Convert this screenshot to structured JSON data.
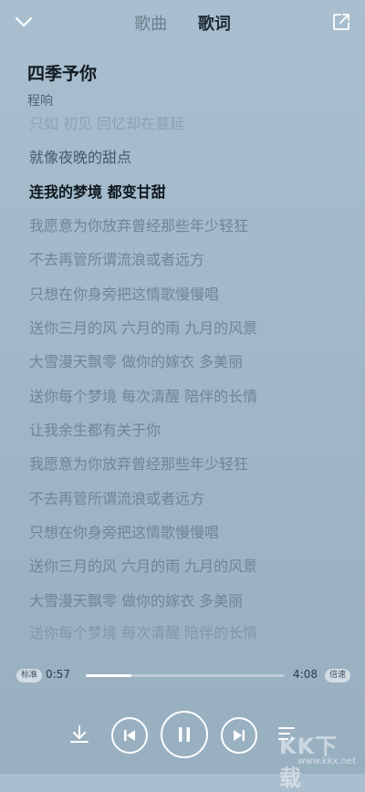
{
  "header": {
    "tabs": [
      {
        "label": "歌曲",
        "active": false
      },
      {
        "label": "歌词",
        "active": true
      }
    ],
    "icons": {
      "back": "chevron-down-icon",
      "share": "share-icon"
    }
  },
  "song": {
    "title": "四季予你",
    "artist": "程响"
  },
  "lyrics": {
    "current_index": 2,
    "lines": [
      "只如 初见 回忆却在蔓延",
      "就像夜晚的甜点",
      "连我的梦境 都变甘甜",
      "我愿意为你放弃曾经那些年少轻狂",
      "不去再管所谓流浪或者远方",
      "只想在你身旁把这情歌慢慢唱",
      "送你三月的风 六月的雨 九月的风景",
      "大雪漫天飘零 做你的嫁衣 多美丽",
      "送你每个梦境 每次清醒 陪伴的长情",
      "让我余生都有关于你",
      "我愿意为你放弃曾经那些年少轻狂",
      "不去再管所谓流浪或者远方",
      "只想在你身旁把这情歌慢慢唱",
      "送你三月的风 六月的雨 九月的风景",
      "大雪漫天飘零 做你的嫁衣 多美丽",
      "送你每个梦境 每次清醒 陪伴的长情"
    ]
  },
  "player": {
    "quality_badge": "标准",
    "speed_badge": "倍速",
    "current_time": "0:57",
    "total_time": "4:08",
    "progress": 0.23
  },
  "controls": {
    "icons": [
      "download-icon",
      "previous-icon",
      "pause-icon",
      "next-icon",
      "playlist-icon"
    ]
  },
  "watermark": {
    "text": "KK下载",
    "url": "www.kkx.net"
  },
  "colors": {
    "background": "#a9bfcf",
    "current_line": "#0e171d",
    "inactive_line": "#6f8595",
    "accent": "#ffffff"
  }
}
